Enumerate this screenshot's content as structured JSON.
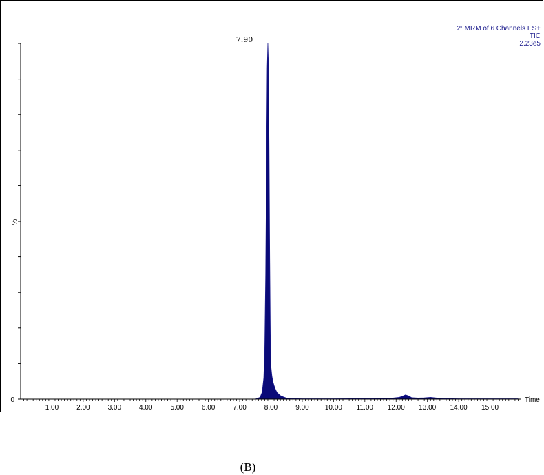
{
  "chart_data": {
    "type": "area",
    "header": [
      "2: MRM of 6 Channels ES+",
      "TIC",
      "2.23e5"
    ],
    "xlabel": "Time",
    "ylabel": "%",
    "xlim": [
      0,
      16
    ],
    "ylim": [
      0,
      100
    ],
    "xticks": [
      "1.00",
      "2.00",
      "3.00",
      "4.00",
      "5.00",
      "6.00",
      "7.00",
      "8.00",
      "9.00",
      "10.00",
      "11.00",
      "12.00",
      "13.00",
      "14.00",
      "15.00"
    ],
    "y_zero_label": "0",
    "peak": {
      "x": 7.9,
      "label": "7.90"
    },
    "fill_color": "#0a0a78",
    "series": [
      {
        "x": [
          0,
          7.5,
          7.65,
          7.72,
          7.77,
          7.8,
          7.83,
          7.86,
          7.88,
          7.9,
          7.92,
          7.94,
          7.96,
          7.98,
          8.0,
          8.03,
          8.06,
          8.1,
          8.15,
          8.2,
          8.3,
          8.4,
          8.5,
          8.7,
          9.0,
          10.0,
          11.0,
          11.3,
          11.6,
          11.9,
          12.1,
          12.2,
          12.3,
          12.4,
          12.5,
          12.7,
          12.9,
          13.1,
          13.3,
          13.6,
          14.0,
          15.0,
          15.9
        ],
        "y": [
          0,
          0,
          0.5,
          2,
          6,
          14,
          35,
          70,
          93,
          100,
          94,
          70,
          40,
          18,
          9,
          6.5,
          5,
          3.8,
          2.6,
          1.8,
          1,
          0.6,
          0.3,
          0.15,
          0.1,
          0.1,
          0.15,
          0.2,
          0.3,
          0.3,
          0.5,
          0.8,
          1.2,
          0.9,
          0.4,
          0.3,
          0.35,
          0.5,
          0.3,
          0.15,
          0.1,
          0.1,
          0.1
        ]
      }
    ]
  },
  "caption": "(B)"
}
